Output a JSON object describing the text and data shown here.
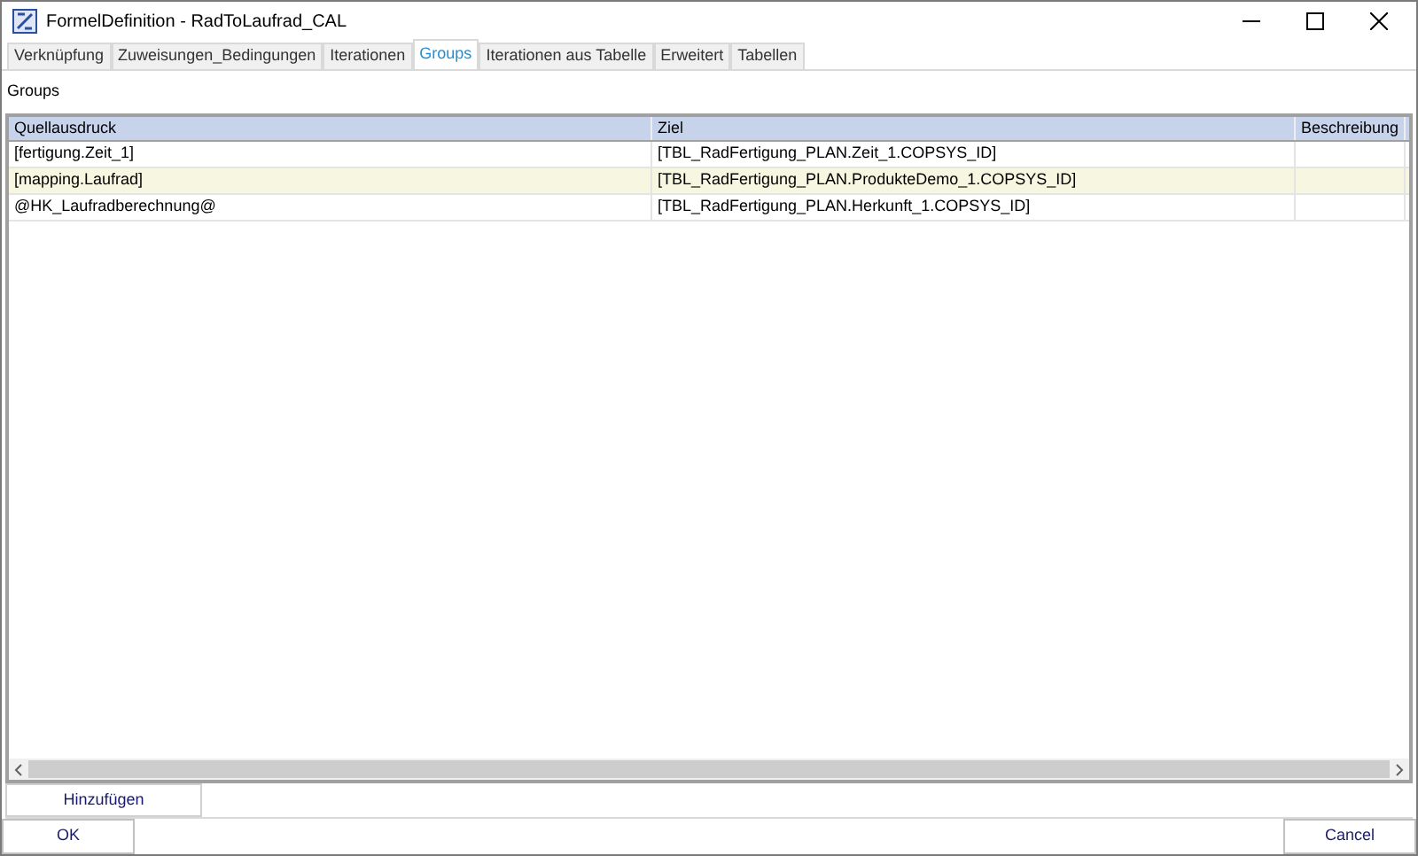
{
  "window": {
    "title": "FormelDefinition - RadToLaufrad_CAL"
  },
  "tabs": [
    {
      "label": "Verknüpfung",
      "selected": false
    },
    {
      "label": "Zuweisungen_Bedingungen",
      "selected": false
    },
    {
      "label": "Iterationen",
      "selected": false
    },
    {
      "label": "Groups",
      "selected": true
    },
    {
      "label": "Iterationen aus Tabelle",
      "selected": false
    },
    {
      "label": "Erweitert",
      "selected": false
    },
    {
      "label": "Tabellen",
      "selected": false
    }
  ],
  "section_label": "Groups",
  "table": {
    "columns": [
      "Quellausdruck",
      "Ziel",
      "Beschreibung"
    ],
    "rows": [
      {
        "cells": [
          "[fertigung.Zeit_1]",
          "[TBL_RadFertigung_PLAN.Zeit_1.COPSYS_ID]",
          ""
        ],
        "selected": false
      },
      {
        "cells": [
          "[mapping.Laufrad]",
          "[TBL_RadFertigung_PLAN.ProdukteDemo_1.COPSYS_ID]",
          ""
        ],
        "selected": true
      },
      {
        "cells": [
          "@HK_Laufradberechnung@",
          "[TBL_RadFertigung_PLAN.Herkunft_1.COPSYS_ID]",
          ""
        ],
        "selected": false
      }
    ]
  },
  "add_button": "Hinzufügen",
  "buttons": {
    "ok": "OK",
    "cancel": "Cancel"
  }
}
